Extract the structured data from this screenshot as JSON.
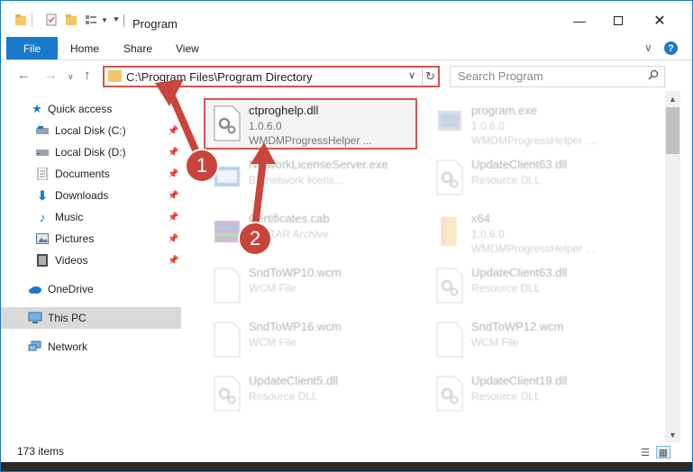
{
  "window": {
    "title": "Program"
  },
  "ribbon": {
    "tabs": [
      {
        "label": "File"
      },
      {
        "label": "Home"
      },
      {
        "label": "Share"
      },
      {
        "label": "View"
      }
    ]
  },
  "nav": {
    "address": "C:\\Program Files\\Program Directory",
    "search_placeholder": "Search Program"
  },
  "sidebar": {
    "items": [
      {
        "label": "Quick access",
        "icon": "star-icon"
      },
      {
        "label": "Local Disk (C:)",
        "icon": "drive-icon"
      },
      {
        "label": "Local Disk (D:)",
        "icon": "drive-icon"
      },
      {
        "label": "Documents",
        "icon": "documents-icon"
      },
      {
        "label": "Downloads",
        "icon": "download-icon"
      },
      {
        "label": "Music",
        "icon": "music-icon"
      },
      {
        "label": "Pictures",
        "icon": "pictures-icon"
      },
      {
        "label": "Videos",
        "icon": "videos-icon"
      },
      {
        "label": "OneDrive",
        "icon": "cloud-icon"
      },
      {
        "label": "This PC",
        "icon": "computer-icon"
      },
      {
        "label": "Network",
        "icon": "network-icon"
      }
    ]
  },
  "files": [
    {
      "name": "ctproghelp.dll",
      "line1": "1.0.6.0",
      "line2": "WMDMProgressHelper ...",
      "icon": "dll-gear-icon"
    },
    {
      "name": "program.exe",
      "line1": "1.0.6.0",
      "line2": "WMDMProgressHelper ...",
      "icon": "exe-icon"
    },
    {
      "name": "NetworkLicenseServer.exe",
      "line1": "BY network licens...",
      "line2": "",
      "icon": "exe-icon"
    },
    {
      "name": "UpdateClient63.dll",
      "line1": "Resource DLL",
      "line2": "",
      "icon": "dll-gear-icon"
    },
    {
      "name": "Certificates.cab",
      "line1": "WinRAR Archive",
      "line2": "",
      "icon": "archive-icon"
    },
    {
      "name": "x64",
      "line1": "1.0.6.0",
      "line2": "WMDMProgressHelper ...",
      "icon": "folder-icon"
    },
    {
      "name": "SndToWP10.wcm",
      "line1": "WCM File",
      "line2": "",
      "icon": "blank-file-icon"
    },
    {
      "name": "UpdateClient63.dll",
      "line1": "Resource DLL",
      "line2": "",
      "icon": "dll-gear-icon"
    },
    {
      "name": "SndToWP16.wcm",
      "line1": "WCM File",
      "line2": "",
      "icon": "blank-file-icon"
    },
    {
      "name": "SndToWP12.wcm",
      "line1": "WCM File",
      "line2": "",
      "icon": "blank-file-icon"
    },
    {
      "name": "UpdateClient5.dll",
      "line1": "Resource DLL",
      "line2": "",
      "icon": "dll-gear-icon"
    },
    {
      "name": "UpdateClient19.dll",
      "line1": "Resource DLL",
      "line2": "",
      "icon": "dll-gear-icon"
    }
  ],
  "status": {
    "item_count": "173 items"
  },
  "callouts": [
    {
      "label": "1"
    },
    {
      "label": "2"
    }
  ],
  "colors": {
    "accent": "#1979ca",
    "callout": "#c9453b",
    "highlight_border": "#d9534f"
  }
}
